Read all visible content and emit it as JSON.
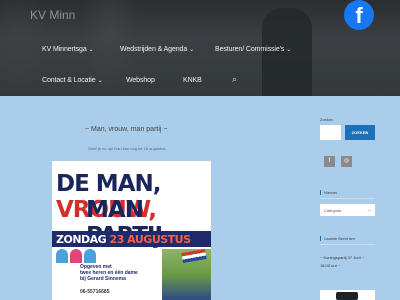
{
  "header": {
    "logo_text": "KV Minn",
    "facebook_glyph": "f",
    "nav_row1": [
      {
        "label": "KV Minnertsga",
        "has_dropdown": true
      },
      {
        "label": "Wedstrijden & Agenda",
        "has_dropdown": true
      },
      {
        "label": "Besturen/ Commissie's",
        "has_dropdown": true
      }
    ],
    "nav_row2": [
      {
        "label": "Contact & Locatie",
        "has_dropdown": true
      },
      {
        "label": "Webshop",
        "has_dropdown": false
      },
      {
        "label": "KNKB",
        "has_dropdown": false
      }
    ],
    "chevron": "⌄",
    "search_glyph": "⌕"
  },
  "article": {
    "title": "~ Man, vrouw, man partij ~",
    "intro": "Geef je nu op! Dan kan nog tot 18 augustus.",
    "poster": {
      "line1_a": "DE MAN, ",
      "line1_b": "VROUW,",
      "line2": "MAN PARTIJ",
      "date_a": "ZONDAG ",
      "date_b": "23 AUGUSTUS",
      "date_c": " 13.00",
      "signup_1": "Opgeven met",
      "signup_2": "twee heren en één dame",
      "signup_3": "bij Gerard Sinnema",
      "phone": "06-55716685"
    }
  },
  "sidebar": {
    "search_label": "Zoeken",
    "search_button": "ZOEKEN",
    "social": [
      {
        "glyph": "f",
        "name": "facebook"
      },
      {
        "glyph": "◎",
        "name": "instagram"
      }
    ],
    "news_heading": "Nieuws",
    "category_placeholder": "Categorie",
    "latest_heading": "Laatste Berichten",
    "latest_post_1": "~ Koningspartij 27 Juni ~",
    "latest_post_2": "18.00 uur ~"
  },
  "colors": {
    "page_bg": "#a9cdeb",
    "accent": "#1d70b8",
    "poster_navy": "#19265e",
    "poster_red": "#d42e2a",
    "facebook_blue": "#1877f2"
  }
}
